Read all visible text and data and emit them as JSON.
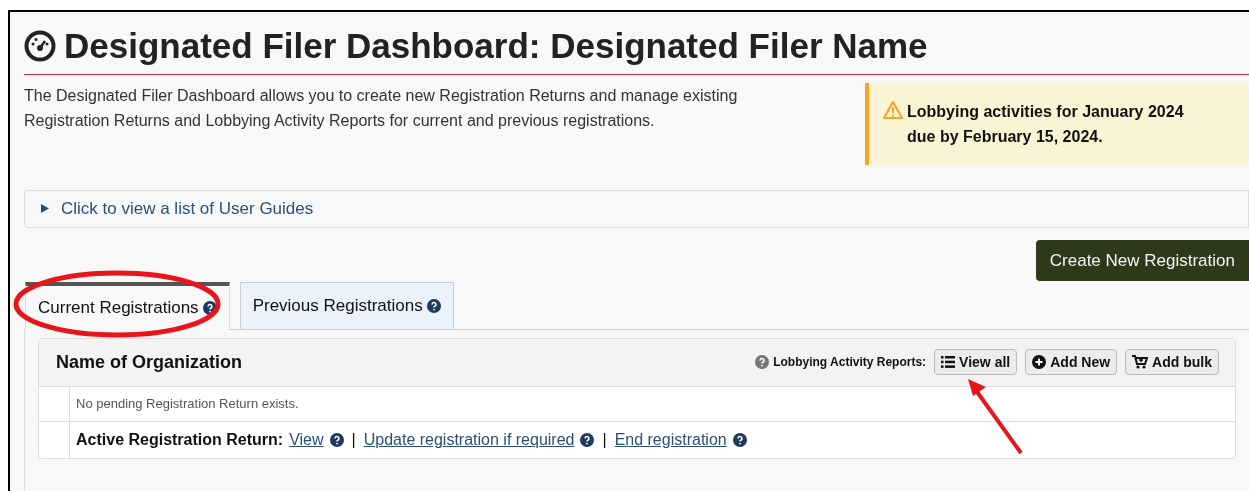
{
  "header": {
    "title": "Designated Filer Dashboard: Designated Filer Name",
    "description": "The Designated Filer Dashboard allows you to create new Registration Returns and manage existing Registration Returns and Lobbying Activity Reports for current and previous registrations."
  },
  "alert": {
    "text": "Lobbying activities for January 2024 due by February 15, 2024."
  },
  "user_guides": {
    "label": "Click to view a list of User Guides",
    "expanded": false
  },
  "create_button": "Create New Registration",
  "tabs": [
    {
      "label": "Current Registrations",
      "selected": true
    },
    {
      "label": "Previous Registrations",
      "selected": false
    }
  ],
  "organization": {
    "name": "Name of Organization",
    "reports_label": "Lobbying Activity Reports:",
    "buttons": [
      {
        "label": "View all",
        "kind": "list"
      },
      {
        "label": "Add New",
        "kind": "add"
      },
      {
        "label": "Add bulk",
        "kind": "cart"
      }
    ],
    "pending": "No pending Registration Return exists.",
    "active_label": "Active Registration Return:",
    "links": [
      "View",
      "Update registration if required",
      "End registration"
    ],
    "separator": "|"
  }
}
